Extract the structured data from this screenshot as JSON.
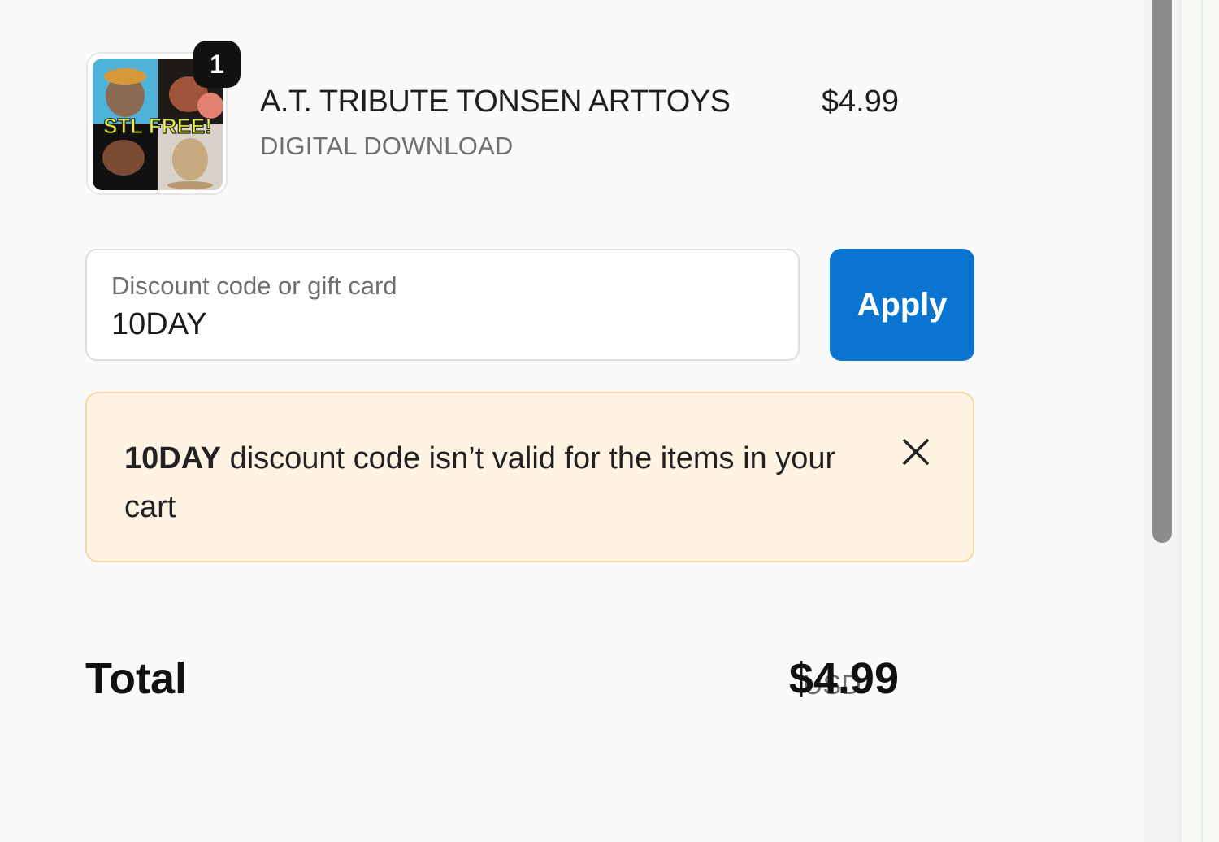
{
  "product": {
    "quantity_badge": "1",
    "title": "A.T. TRIBUTE TONSEN ARTTOYS",
    "subtitle": "DIGITAL DOWNLOAD",
    "price": "$4.99",
    "image_overlay_text": "STL FREE!"
  },
  "discount": {
    "label": "Discount code or gift card",
    "value": "10DAY",
    "apply_label": "Apply"
  },
  "alert": {
    "code": "10DAY",
    "message": " discount code isn’t valid for the items in your cart",
    "close_icon": "close-icon"
  },
  "total": {
    "label": "Total",
    "currency": "USD",
    "amount": "$4.99"
  },
  "colors": {
    "accent": "#0a74d1",
    "alert_bg": "#fff4e4",
    "alert_border": "#fbd6a2"
  }
}
